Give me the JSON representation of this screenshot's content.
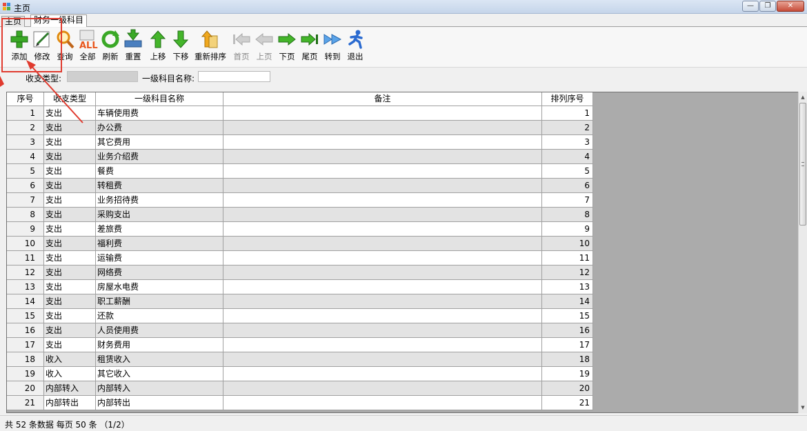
{
  "window": {
    "title": "主页"
  },
  "tabs": [
    {
      "label": "主页",
      "active": false
    },
    {
      "label": "财务一级科目",
      "active": true
    }
  ],
  "toolbar": [
    {
      "label": "添加",
      "icon": "plus-icon",
      "enabled": true
    },
    {
      "label": "修改",
      "icon": "edit-icon",
      "enabled": true
    },
    {
      "label": "查询",
      "icon": "search-icon",
      "enabled": true
    },
    {
      "label": "全部",
      "icon": "all-icon",
      "enabled": true
    },
    {
      "label": "刷新",
      "icon": "refresh-icon",
      "enabled": true
    },
    {
      "label": "重置",
      "icon": "reset-icon",
      "enabled": true
    },
    {
      "label": "上移",
      "icon": "arrow-up-icon",
      "enabled": true
    },
    {
      "label": "下移",
      "icon": "arrow-down-icon",
      "enabled": true
    },
    {
      "label": "重新排序",
      "icon": "resort-icon",
      "enabled": true
    },
    {
      "label": "首页",
      "icon": "first-page-icon",
      "enabled": false
    },
    {
      "label": "上页",
      "icon": "prev-page-icon",
      "enabled": false
    },
    {
      "label": "下页",
      "icon": "next-page-icon",
      "enabled": true
    },
    {
      "label": "尾页",
      "icon": "last-page-icon",
      "enabled": true
    },
    {
      "label": "转到",
      "icon": "goto-icon",
      "enabled": true
    },
    {
      "label": "退出",
      "icon": "exit-icon",
      "enabled": true
    }
  ],
  "filters": {
    "type_label": "收支类型:",
    "type_value": "",
    "name_label": "一级科目名称:",
    "name_value": ""
  },
  "grid": {
    "columns": [
      "序号",
      "收支类型",
      "一级科目名称",
      "备注",
      "排列序号"
    ],
    "rows": [
      [
        "1",
        "支出",
        "车辆使用费",
        "",
        "1"
      ],
      [
        "2",
        "支出",
        "办公费",
        "",
        "2"
      ],
      [
        "3",
        "支出",
        "其它费用",
        "",
        "3"
      ],
      [
        "4",
        "支出",
        "业务介绍费",
        "",
        "4"
      ],
      [
        "5",
        "支出",
        "餐费",
        "",
        "5"
      ],
      [
        "6",
        "支出",
        "转租费",
        "",
        "6"
      ],
      [
        "7",
        "支出",
        "业务招待费",
        "",
        "7"
      ],
      [
        "8",
        "支出",
        "采购支出",
        "",
        "8"
      ],
      [
        "9",
        "支出",
        "差旅费",
        "",
        "9"
      ],
      [
        "10",
        "支出",
        "福利费",
        "",
        "10"
      ],
      [
        "11",
        "支出",
        "运输费",
        "",
        "11"
      ],
      [
        "12",
        "支出",
        "网络费",
        "",
        "12"
      ],
      [
        "13",
        "支出",
        "房屋水电费",
        "",
        "13"
      ],
      [
        "14",
        "支出",
        "职工薪酬",
        "",
        "14"
      ],
      [
        "15",
        "支出",
        "还款",
        "",
        "15"
      ],
      [
        "16",
        "支出",
        "人员使用费",
        "",
        "16"
      ],
      [
        "17",
        "支出",
        "财务费用",
        "",
        "17"
      ],
      [
        "18",
        "收入",
        "租赁收入",
        "",
        "18"
      ],
      [
        "19",
        "收入",
        "其它收入",
        "",
        "19"
      ],
      [
        "20",
        "内部转入",
        "内部转入",
        "",
        "20"
      ],
      [
        "21",
        "内部转出",
        "内部转出",
        "",
        "21"
      ]
    ]
  },
  "status": {
    "text": "共 52 条数据  每页 50 条 （1/2）"
  },
  "colors": {
    "annotation": "#e03a2e",
    "grid_alt_row": "#e3e3e3",
    "grid_empty": "#ababab"
  }
}
